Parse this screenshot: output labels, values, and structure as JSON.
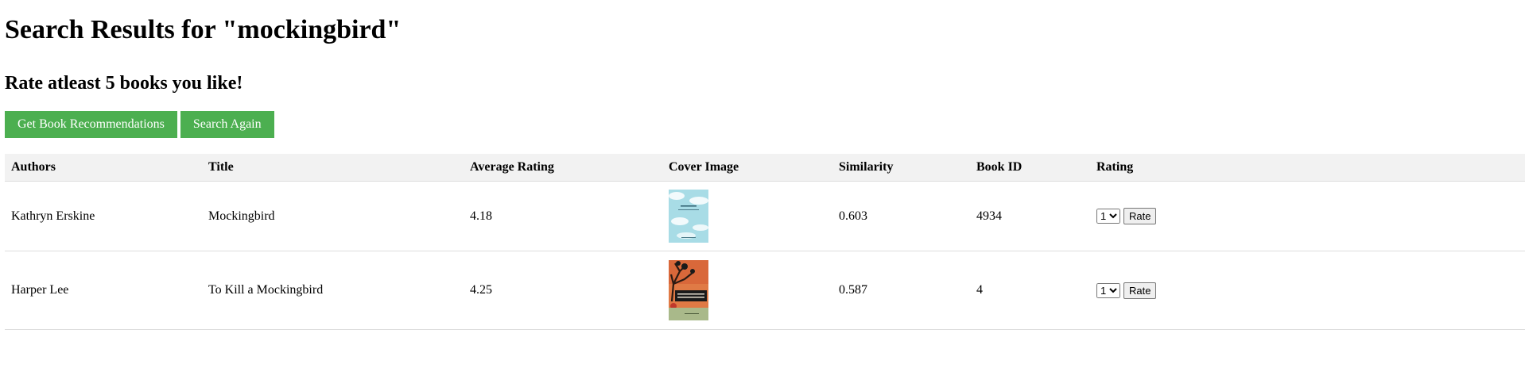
{
  "page": {
    "title": "Search Results for \"mockingbird\"",
    "subtitle": "Rate atleast 5 books you like!"
  },
  "actions": {
    "recommend_label": "Get Book Recommendations",
    "search_again_label": "Search Again",
    "button_color": "#4caf50"
  },
  "table": {
    "headers": {
      "authors": "Authors",
      "title": "Title",
      "average_rating": "Average Rating",
      "cover_image": "Cover Image",
      "similarity": "Similarity",
      "book_id": "Book ID",
      "rating": "Rating"
    },
    "rows": [
      {
        "authors": "Kathryn Erskine",
        "title": "Mockingbird",
        "average_rating": "4.18",
        "similarity": "0.603",
        "book_id": "4934",
        "rating_value": "1",
        "rate_label": "Rate"
      },
      {
        "authors": "Harper Lee",
        "title": "To Kill a Mockingbird",
        "average_rating": "4.25",
        "similarity": "0.587",
        "book_id": "4",
        "rating_value": "1",
        "rate_label": "Rate"
      }
    ]
  }
}
